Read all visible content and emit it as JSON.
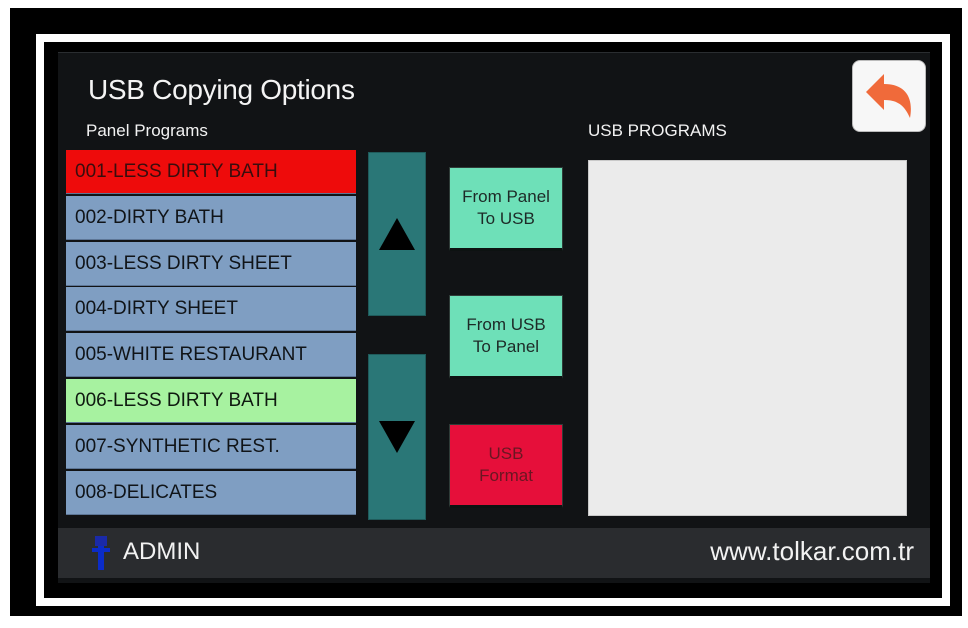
{
  "window": {
    "title": "USB Copying Options"
  },
  "panel_programs": {
    "label": "Panel Programs",
    "items": [
      {
        "label": "001-LESS DIRTY BATH",
        "state": "selected-red"
      },
      {
        "label": "002-DIRTY BATH",
        "state": "normal"
      },
      {
        "label": "003-LESS DIRTY SHEET",
        "state": "normal"
      },
      {
        "label": "004-DIRTY SHEET",
        "state": "normal"
      },
      {
        "label": "005-WHITE RESTAURANT",
        "state": "normal"
      },
      {
        "label": "006-LESS DIRTY BATH",
        "state": "selected-green"
      },
      {
        "label": "007-SYNTHETIC REST.",
        "state": "normal"
      },
      {
        "label": "008-DELICATES",
        "state": "normal"
      }
    ]
  },
  "scroll": {
    "up_icon": "triangle-up-icon",
    "down_icon": "triangle-down-icon"
  },
  "actions": {
    "panel_to_usb": "From Panel\nTo USB",
    "usb_to_panel": "From USB\nTo Panel",
    "usb_format": "USB\nFormat"
  },
  "usb_programs": {
    "label": "USB PROGRAMS",
    "items": []
  },
  "status": {
    "user": "ADMIN",
    "website": "www.tolkar.com.tr"
  },
  "colors": {
    "selected_red": "#ee0b0b",
    "selected_green": "#a7f2a0",
    "list_item": "#7f9ec2",
    "scroll_button": "#2a7777",
    "action_teal": "#6ee0b8",
    "action_red": "#e60f3a",
    "back_arrow": "#f06a3a"
  }
}
